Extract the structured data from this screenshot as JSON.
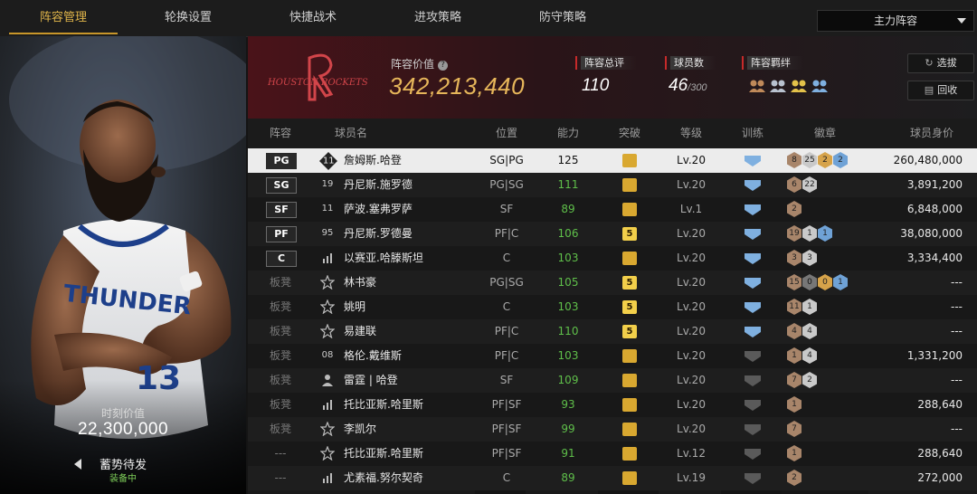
{
  "nav": {
    "tabs": [
      "阵容管理",
      "轮换设置",
      "快捷战术",
      "进攻策略",
      "防守策略"
    ],
    "active_tab": 0,
    "lineup_select": "主力阵容"
  },
  "player_panel": {
    "jersey_text": "THUNDER",
    "jersey_number": "13",
    "moment_value_label": "时刻价值",
    "moment_value": "22,300,000",
    "skill_name": "蓄势待发",
    "skill_status": "装备中"
  },
  "team": {
    "logo_text": "HOUSTON ROCKETS",
    "value_label": "阵容价值",
    "value": "342,213,440",
    "overall_label": "阵容总评",
    "overall": "110",
    "player_count_label": "球员数",
    "player_count": "46",
    "player_count_max": "/300",
    "bonds_label": "阵容羁绊",
    "release_button": "选拔",
    "recycle_button": "回收"
  },
  "table": {
    "headers": [
      "阵容",
      "球员名",
      "位置",
      "能力",
      "突破",
      "等级",
      "训练",
      "徽章",
      "球员身价"
    ],
    "rows": [
      {
        "slot": "PG",
        "starter": true,
        "num": "11",
        "num_style": "diamond",
        "name": "詹姆斯.哈登",
        "pos": "SG|PG",
        "ability": "125",
        "break": "",
        "level": "Lv.20",
        "train": "blue",
        "badges": [
          [
            "8",
            "brown"
          ],
          [
            "25",
            "silver"
          ],
          [
            "2",
            "gold"
          ],
          [
            "2",
            "blue"
          ]
        ],
        "value": "260,480,000"
      },
      {
        "slot": "SG",
        "starter": true,
        "num": "19",
        "num_style": "plain",
        "name": "丹尼斯.施罗德",
        "pos": "PG|SG",
        "ability": "111",
        "break": "",
        "level": "Lv.20",
        "train": "blue",
        "badges": [
          [
            "6",
            "brown"
          ],
          [
            "22",
            "silver"
          ]
        ],
        "value": "3,891,200"
      },
      {
        "slot": "SF",
        "starter": true,
        "num": "11",
        "num_style": "plain",
        "name": "萨波.塞弗罗萨",
        "pos": "SF",
        "ability": "89",
        "break": "",
        "level": "Lv.1",
        "train": "blue",
        "badges": [
          [
            "2",
            "brown"
          ]
        ],
        "value": "6,848,000"
      },
      {
        "slot": "PF",
        "starter": true,
        "num": "95",
        "num_style": "plain",
        "name": "丹尼斯.罗德曼",
        "pos": "PF|C",
        "ability": "106",
        "break": "5",
        "level": "Lv.20",
        "train": "blue",
        "badges": [
          [
            "19",
            "brown"
          ],
          [
            "1",
            "silver"
          ],
          [
            "1",
            "blue"
          ]
        ],
        "value": "38,080,000"
      },
      {
        "slot": "C",
        "starter": true,
        "num": "bars",
        "num_style": "icon",
        "name": "以赛亚.哈滕斯坦",
        "pos": "C",
        "ability": "103",
        "break": "",
        "level": "Lv.20",
        "train": "blue",
        "badges": [
          [
            "3",
            "brown"
          ],
          [
            "3",
            "silver"
          ]
        ],
        "value": "3,334,400"
      },
      {
        "slot": "板凳",
        "starter": false,
        "num": "star",
        "num_style": "icon",
        "name": "林书豪",
        "pos": "PG|SG",
        "ability": "105",
        "break": "5",
        "level": "Lv.20",
        "train": "blue",
        "badges": [
          [
            "15",
            "brown"
          ],
          [
            "0",
            "gray"
          ],
          [
            "0",
            "gold"
          ],
          [
            "1",
            "blue"
          ]
        ],
        "value": "---"
      },
      {
        "slot": "板凳",
        "starter": false,
        "num": "star",
        "num_style": "icon",
        "name": "姚明",
        "pos": "C",
        "ability": "103",
        "break": "5",
        "level": "Lv.20",
        "train": "blue",
        "badges": [
          [
            "11",
            "brown"
          ],
          [
            "1",
            "silver"
          ]
        ],
        "value": "---"
      },
      {
        "slot": "板凳",
        "starter": false,
        "num": "star",
        "num_style": "icon",
        "name": "易建联",
        "pos": "PF|C",
        "ability": "110",
        "break": "5",
        "level": "Lv.20",
        "train": "blue",
        "badges": [
          [
            "4",
            "brown"
          ],
          [
            "4",
            "silver"
          ]
        ],
        "value": "---"
      },
      {
        "slot": "板凳",
        "starter": false,
        "num": "08",
        "num_style": "plain",
        "name": "格伦.戴维斯",
        "pos": "PF|C",
        "ability": "103",
        "break": "",
        "level": "Lv.20",
        "train": "gray",
        "badges": [
          [
            "1",
            "brown"
          ],
          [
            "4",
            "silver"
          ]
        ],
        "value": "1,331,200"
      },
      {
        "slot": "板凳",
        "starter": false,
        "num": "person",
        "num_style": "icon",
        "name": "雷霆 | 哈登",
        "pos": "SF",
        "ability": "109",
        "break": "",
        "level": "Lv.20",
        "train": "gray",
        "badges": [
          [
            "7",
            "brown"
          ],
          [
            "2",
            "silver"
          ]
        ],
        "value": "---"
      },
      {
        "slot": "板凳",
        "starter": false,
        "num": "bars",
        "num_style": "icon",
        "name": "托比亚斯.哈里斯",
        "pos": "PF|SF",
        "ability": "93",
        "break": "",
        "level": "Lv.20",
        "train": "gray",
        "badges": [
          [
            "1",
            "brown"
          ]
        ],
        "value": "288,640"
      },
      {
        "slot": "板凳",
        "starter": false,
        "num": "star",
        "num_style": "icon",
        "name": "李凯尔",
        "pos": "PF|SF",
        "ability": "99",
        "break": "",
        "level": "Lv.20",
        "train": "gray",
        "badges": [
          [
            "7",
            "brown"
          ]
        ],
        "value": "---"
      },
      {
        "slot": "---",
        "starter": false,
        "num": "star",
        "num_style": "icon",
        "name": "托比亚斯.哈里斯",
        "pos": "PF|SF",
        "ability": "91",
        "break": "",
        "level": "Lv.12",
        "train": "gray",
        "badges": [
          [
            "1",
            "brown"
          ]
        ],
        "value": "288,640"
      },
      {
        "slot": "---",
        "starter": false,
        "num": "bars",
        "num_style": "icon",
        "name": "尤素福.努尔契奇",
        "pos": "C",
        "ability": "89",
        "break": "",
        "level": "Lv.19",
        "train": "gray",
        "badges": [
          [
            "2",
            "brown"
          ]
        ],
        "value": "272,000"
      }
    ]
  },
  "colors": {
    "accent": "#e0b54a",
    "ability_green": "#5fbf4a",
    "team_red": "#c62a2a",
    "train_blue": "#7fb0e0",
    "train_gray": "#5a5a5a"
  }
}
